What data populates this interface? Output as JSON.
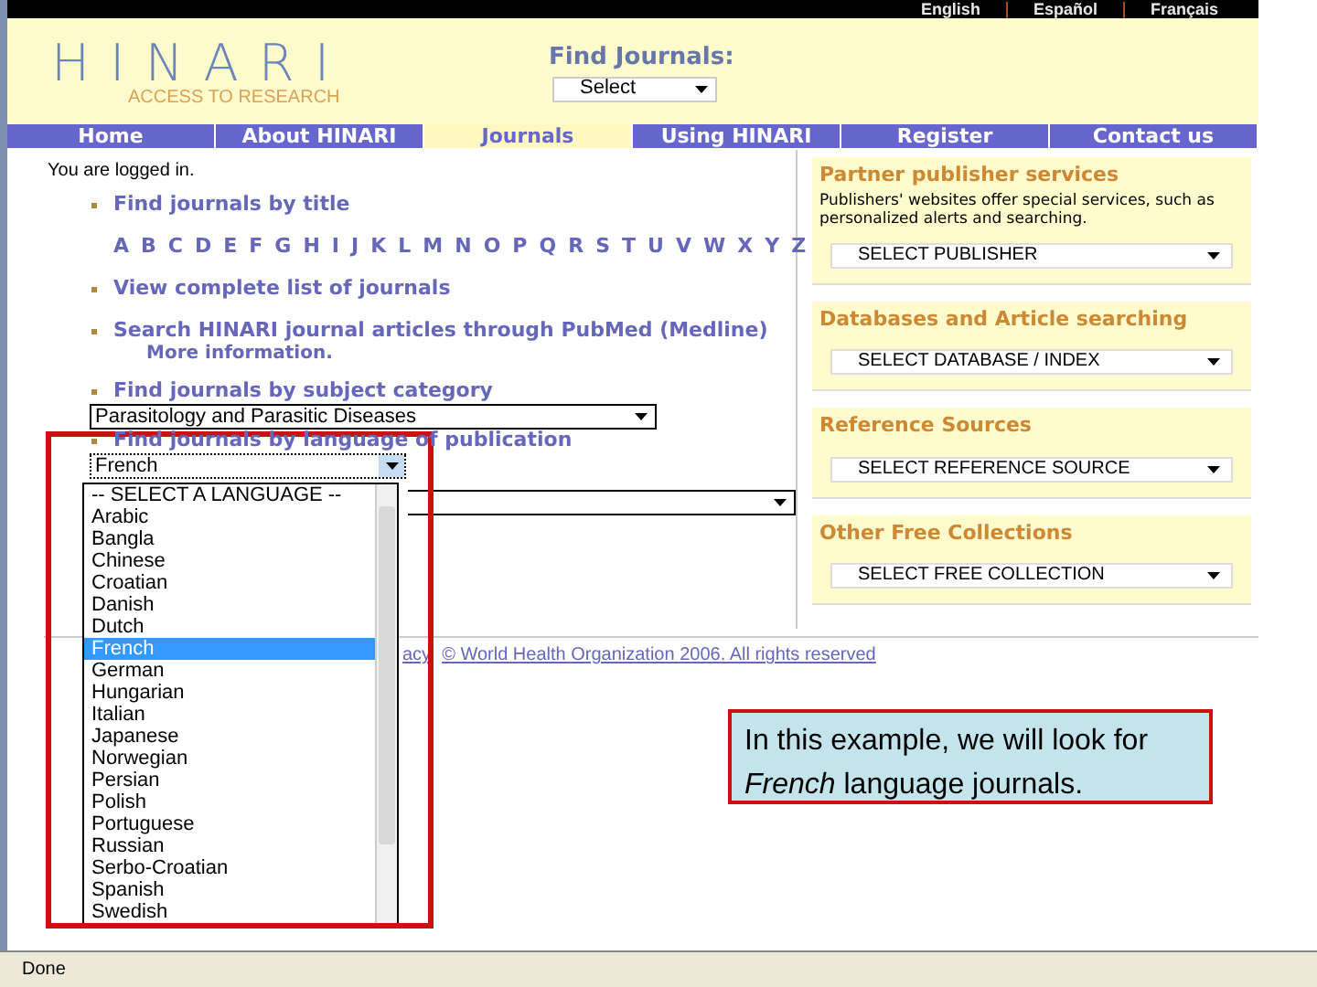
{
  "language_links": [
    "English",
    "Español",
    "Français"
  ],
  "logo": {
    "name": "HINARI",
    "tagline": "ACCESS TO RESEARCH"
  },
  "find_journals": {
    "label": "Find Journals:",
    "value": "Select"
  },
  "nav_tabs": [
    {
      "label": "Home",
      "selected": false
    },
    {
      "label": "About HINARI",
      "selected": false
    },
    {
      "label": "Journals",
      "selected": true
    },
    {
      "label": "Using HINARI",
      "selected": false
    },
    {
      "label": "Register",
      "selected": false
    },
    {
      "label": "Contact us",
      "selected": false
    }
  ],
  "login_status": "You are logged in.",
  "find_by_title": "Find journals by title",
  "alphabet": [
    "A",
    "B",
    "C",
    "D",
    "E",
    "F",
    "G",
    "H",
    "I",
    "J",
    "K",
    "L",
    "M",
    "N",
    "O",
    "P",
    "Q",
    "R",
    "S",
    "T",
    "U",
    "V",
    "W",
    "X",
    "Y",
    "Z"
  ],
  "complete_list": "View complete list of journals",
  "pubmed": {
    "label": "Search HINARI journal articles through PubMed (Medline)",
    "more": "More information."
  },
  "subject": {
    "label": "Find journals by subject category",
    "value": "Parasitology and Parasitic Diseases"
  },
  "language": {
    "label": "Find journals by language of publication",
    "value": "French",
    "options": [
      {
        "label": "-- SELECT A LANGUAGE --",
        "selected": false
      },
      {
        "label": "Arabic",
        "selected": false
      },
      {
        "label": "Bangla",
        "selected": false
      },
      {
        "label": "Chinese",
        "selected": false
      },
      {
        "label": "Croatian",
        "selected": false
      },
      {
        "label": "Danish",
        "selected": false
      },
      {
        "label": "Dutch",
        "selected": false
      },
      {
        "label": "French",
        "selected": true
      },
      {
        "label": "German",
        "selected": false
      },
      {
        "label": "Hungarian",
        "selected": false
      },
      {
        "label": "Italian",
        "selected": false
      },
      {
        "label": "Japanese",
        "selected": false
      },
      {
        "label": "Norwegian",
        "selected": false
      },
      {
        "label": "Persian",
        "selected": false
      },
      {
        "label": "Polish",
        "selected": false
      },
      {
        "label": "Portuguese",
        "selected": false
      },
      {
        "label": "Russian",
        "selected": false
      },
      {
        "label": "Serbo-Croatian",
        "selected": false
      },
      {
        "label": "Spanish",
        "selected": false
      },
      {
        "label": "Swedish",
        "selected": false
      }
    ]
  },
  "footer": {
    "link_fragment": "acy",
    "copyright": "© World Health Organization 2006. All rights reserved"
  },
  "side_boxes": [
    {
      "heading": "Partner publisher services",
      "description": "Publishers' websites offer special services, such as personalized alerts and searching.",
      "select": "SELECT PUBLISHER"
    },
    {
      "heading": "Databases and Article searching",
      "select": "SELECT DATABASE / INDEX"
    },
    {
      "heading": "Reference Sources",
      "select": "SELECT REFERENCE SOURCE"
    },
    {
      "heading": "Other Free Collections",
      "select": "SELECT FREE COLLECTION"
    }
  ],
  "status_bar": "Done",
  "callout": "In this example, we will look for *French* language journals."
}
